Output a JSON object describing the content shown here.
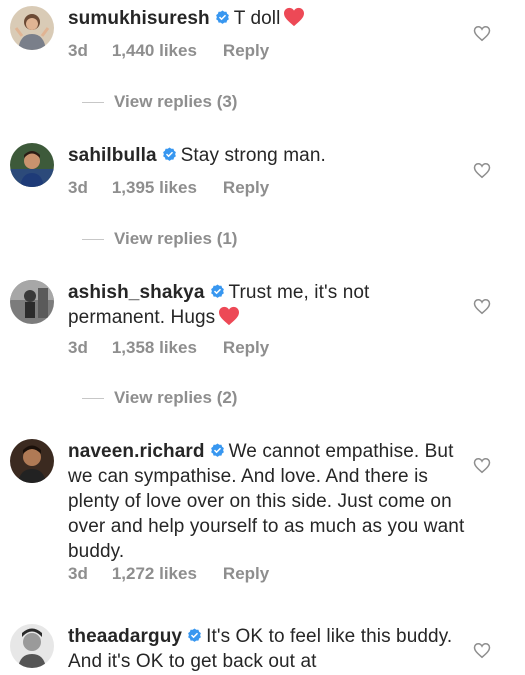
{
  "comments": [
    {
      "username": "sumukhisuresh",
      "text": "T doll",
      "has_heart": true,
      "time": "3d",
      "likes": "1,440 likes",
      "reply_label": "Reply",
      "view_replies": "View replies (3)",
      "avatar_icon": "avatar-sumukhisuresh"
    },
    {
      "username": "sahilbulla",
      "text": "Stay strong man.",
      "has_heart": false,
      "time": "3d",
      "likes": "1,395 likes",
      "reply_label": "Reply",
      "view_replies": "View replies (1)",
      "avatar_icon": "avatar-sahilbulla"
    },
    {
      "username": "ashish_shakya",
      "text": "Trust me, it's not permanent. Hugs",
      "has_heart": true,
      "time": "3d",
      "likes": "1,358 likes",
      "reply_label": "Reply",
      "view_replies": "View replies (2)",
      "avatar_icon": "avatar-ashish-shakya"
    },
    {
      "username": "naveen.richard",
      "text": "We cannot empathise. But we can sympathise. And love. And there is plenty of love over on this side. Just come on over and help yourself to as much as you want buddy.",
      "has_heart": false,
      "time": "3d",
      "likes": "1,272 likes",
      "reply_label": "Reply",
      "avatar_icon": "avatar-naveen-richard"
    },
    {
      "username": "theaadarguy",
      "text": "It's OK to feel like this buddy. And it's OK to get back out at",
      "has_heart": false,
      "avatar_icon": "avatar-theaadarguy"
    }
  ],
  "colors": {
    "verified": "#3897f0",
    "heart": "#ed4956",
    "muted": "#8e8e8e",
    "text": "#262626"
  }
}
